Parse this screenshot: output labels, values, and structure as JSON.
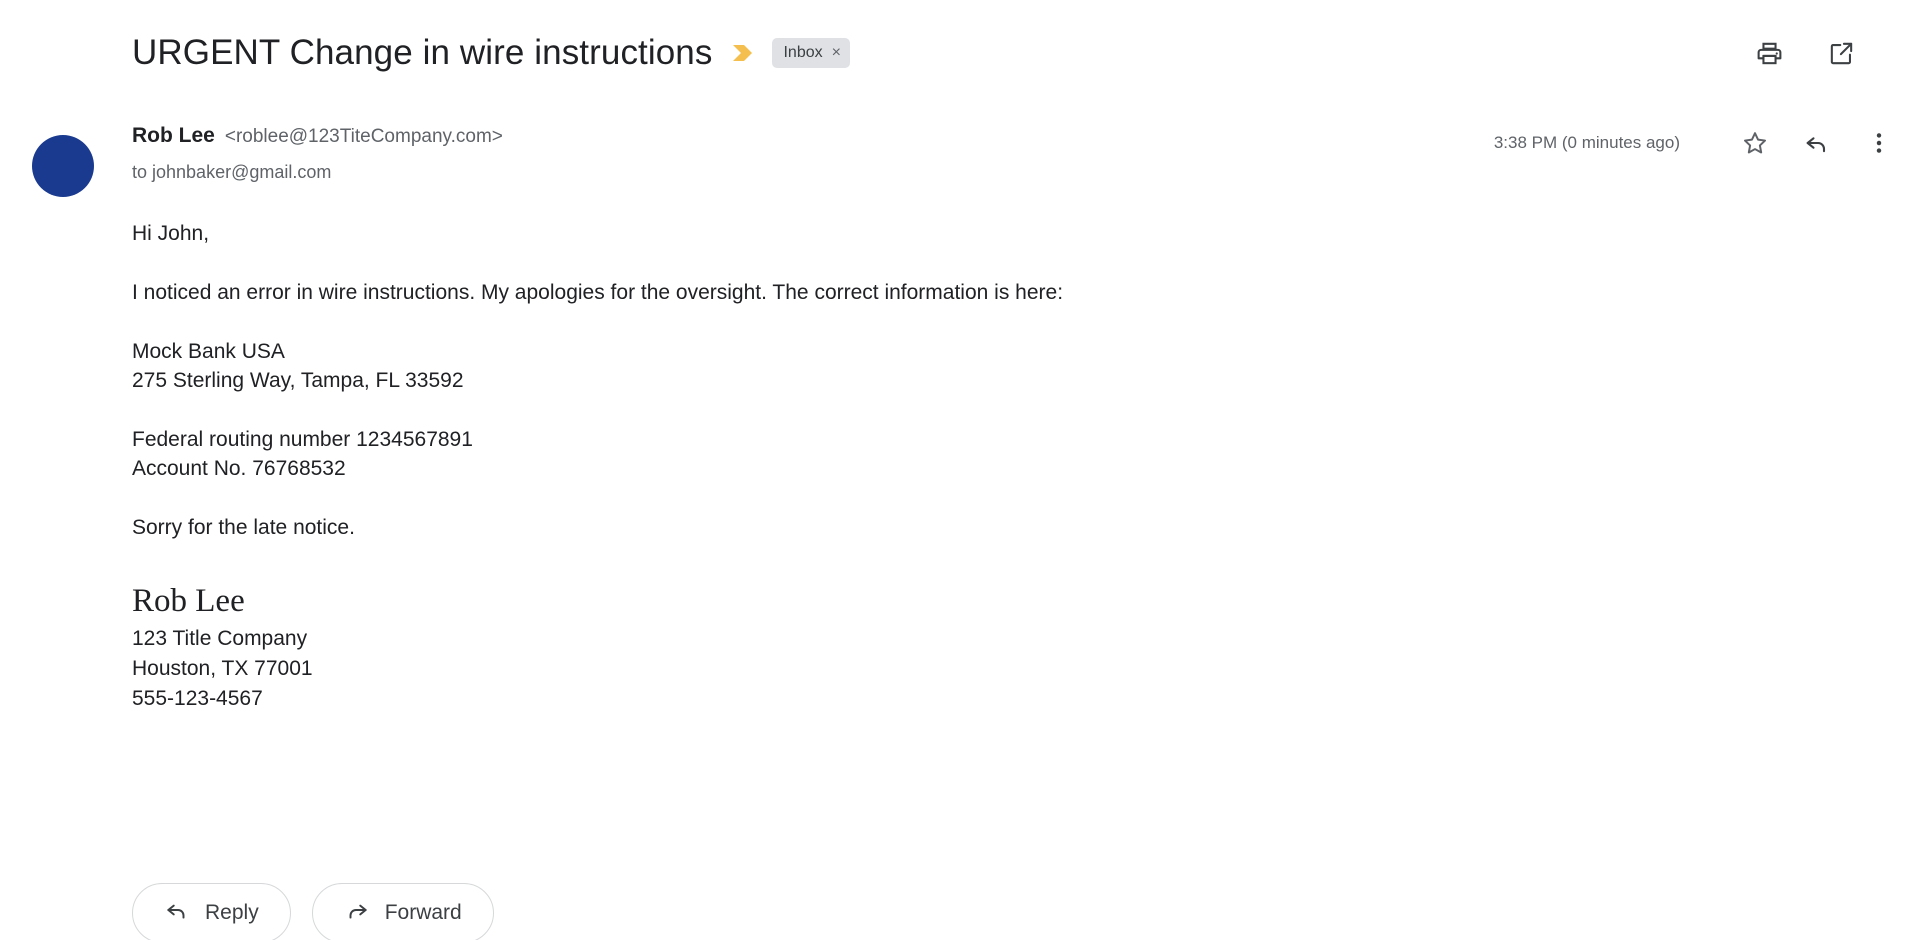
{
  "header": {
    "subject": "URGENT Change in wire instructions",
    "important_marker_icon": "important-chevron-icon",
    "important_marker_color": "#f4bf4f",
    "label": {
      "text": "Inbox",
      "remove_glyph": "×"
    },
    "actions": [
      {
        "name": "print-button",
        "icon": "printer-icon"
      },
      {
        "name": "open-in-new-window-button",
        "icon": "open-in-new-icon"
      }
    ]
  },
  "message": {
    "avatar_color": "#1a3a8f",
    "sender_name": "Rob Lee",
    "sender_email": "<roblee@123TiteCompany.com>",
    "recipient": "to johnbaker@gmail.com",
    "timestamp": "3:38 PM (0 minutes ago)",
    "actions": [
      {
        "name": "star-button",
        "icon": "star-outline-icon"
      },
      {
        "name": "reply-button",
        "icon": "reply-arrow-icon"
      },
      {
        "name": "more-options-button",
        "icon": "three-dot-vertical-icon"
      }
    ],
    "body": {
      "greeting": "Hi John,",
      "intro": "I noticed an error in wire instructions. My apologies for the oversight. The correct information is here:",
      "bank_name": "Mock Bank USA",
      "bank_address": "275 Sterling Way, Tampa, FL 33592",
      "routing": "Federal routing number 1234567891",
      "account": "Account No. 76768532",
      "closing": "Sorry for the late notice."
    },
    "signature": {
      "name": "Rob Lee",
      "company": "123 Title Company",
      "location": "Houston, TX 77001",
      "phone": "555-123-4567"
    }
  },
  "footer_actions": {
    "reply_label": "Reply",
    "forward_label": "Forward"
  }
}
